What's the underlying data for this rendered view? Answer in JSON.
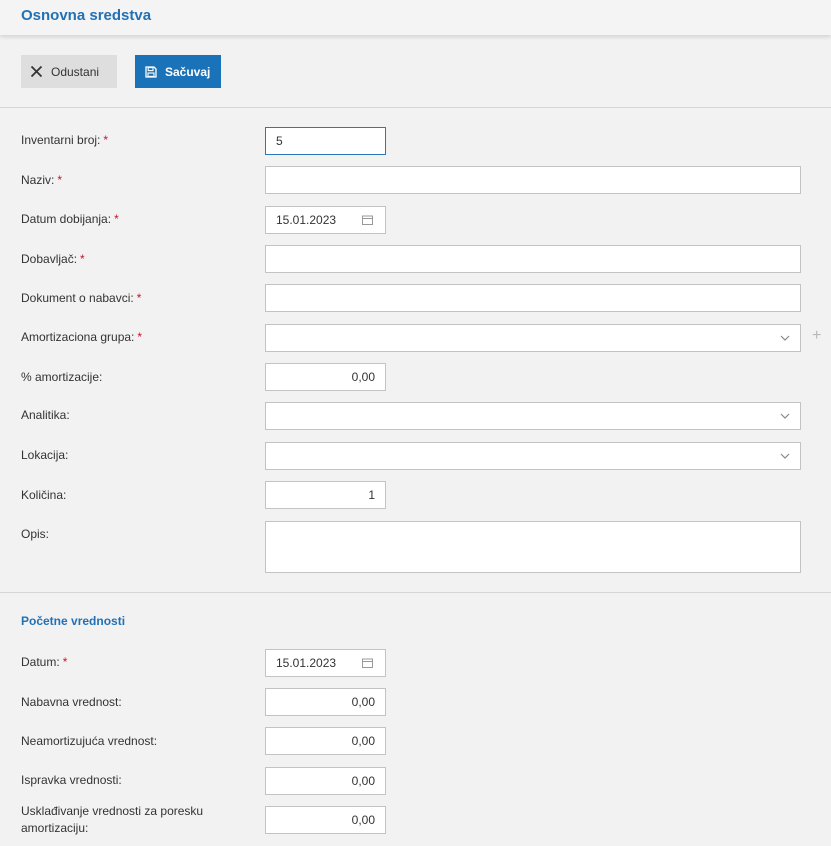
{
  "header": {
    "title": "Osnovna sredstva"
  },
  "toolbar": {
    "cancel_label": "Odustani",
    "save_label": "Sačuvaj"
  },
  "form": {
    "inventory_number": {
      "label": "Inventarni broj:",
      "required": "*",
      "value": "5"
    },
    "name": {
      "label": "Naziv:",
      "required": "*",
      "value": ""
    },
    "acquisition_date": {
      "label": "Datum dobijanja:",
      "required": "*",
      "value": "15.01.2023"
    },
    "supplier": {
      "label": "Dobavljač:",
      "required": "*",
      "value": ""
    },
    "purchase_document": {
      "label": "Dokument o nabavci:",
      "required": "*",
      "value": ""
    },
    "depreciation_group": {
      "label": "Amortizaciona grupa:",
      "required": "*",
      "value": "",
      "add_icon": "plus-icon"
    },
    "depreciation_percent": {
      "label": "% amortizacije:",
      "value": "0,00"
    },
    "analytics": {
      "label": "Analitika:",
      "value": ""
    },
    "location": {
      "label": "Lokacija:",
      "value": ""
    },
    "quantity": {
      "label": "Količina:",
      "value": "1"
    },
    "description": {
      "label": "Opis:",
      "value": ""
    }
  },
  "initial_values": {
    "title": "Početne vrednosti",
    "date": {
      "label": "Datum:",
      "required": "*",
      "value": "15.01.2023"
    },
    "purchase_value": {
      "label": "Nabavna vrednost:",
      "value": "0,00"
    },
    "non_depreciable_value": {
      "label": "Neamortizujuća vrednost:",
      "value": "0,00"
    },
    "value_correction": {
      "label": "Ispravka vrednosti:",
      "value": "0,00"
    },
    "tax_adjustment": {
      "label": "Usklađivanje vrednosti za poresku amortizaciju:",
      "value": "0,00"
    }
  },
  "colors": {
    "accent": "#1a73b8",
    "title": "#2271b5",
    "required": "#c8102e",
    "background": "#f2f2f2"
  }
}
